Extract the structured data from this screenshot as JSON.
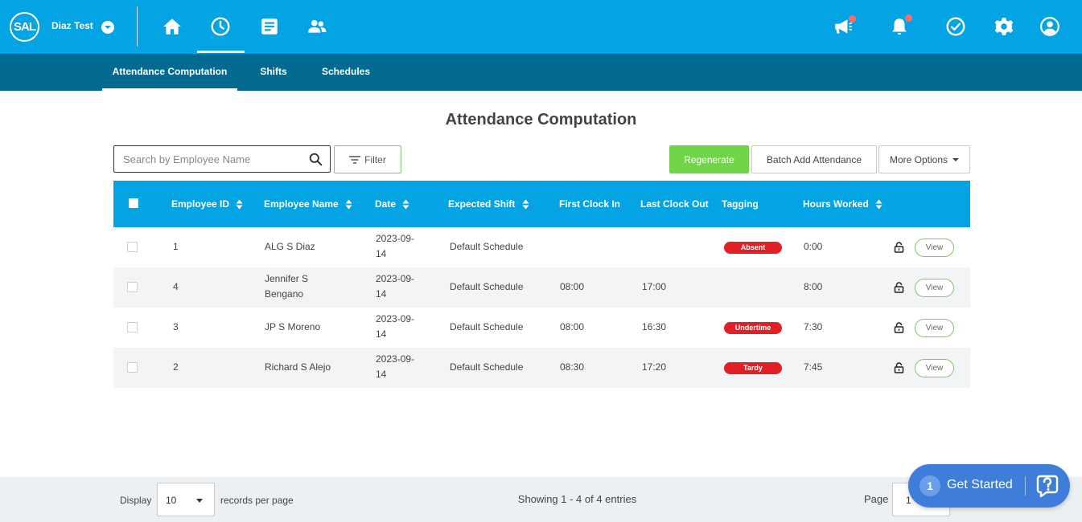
{
  "header": {
    "logo_text": "SAL",
    "company_name": "Diaz Test"
  },
  "subnav": {
    "tabs": [
      {
        "label": "Attendance Computation",
        "active": true
      },
      {
        "label": "Shifts",
        "active": false
      },
      {
        "label": "Schedules",
        "active": false
      }
    ]
  },
  "page": {
    "title": "Attendance Computation"
  },
  "toolbar": {
    "search_placeholder": "Search by Employee Name",
    "filter_label": "Filter",
    "regenerate_label": "Regenerate",
    "batch_label": "Batch Add Attendance",
    "more_label": "More Options"
  },
  "table": {
    "columns": {
      "employee_id": "Employee ID",
      "employee_name": "Employee Name",
      "date": "Date",
      "expected_shift": "Expected Shift",
      "first_clock_in": "First Clock In",
      "last_clock_out": "Last Clock Out",
      "tagging": "Tagging",
      "hours_worked": "Hours Worked"
    },
    "view_label": "View",
    "rows": [
      {
        "id": "1",
        "name_1": "ALG S Diaz",
        "name_2": "",
        "date_1": "2023-09-",
        "date_2": "14",
        "shift": "Default Schedule",
        "clock_in": "",
        "clock_out": "",
        "tag": "Absent",
        "hours": "0:00"
      },
      {
        "id": "4",
        "name_1": "Jennifer S",
        "name_2": "Bengano",
        "date_1": "2023-09-",
        "date_2": "14",
        "shift": "Default Schedule",
        "clock_in": "08:00",
        "clock_out": "17:00",
        "tag": "",
        "hours": "8:00"
      },
      {
        "id": "3",
        "name_1": "JP S Moreno",
        "name_2": "",
        "date_1": "2023-09-",
        "date_2": "14",
        "shift": "Default Schedule",
        "clock_in": "08:00",
        "clock_out": "16:30",
        "tag": "Undertime",
        "hours": "7:30"
      },
      {
        "id": "2",
        "name_1": "Richard S Alejo",
        "name_2": "",
        "date_1": "2023-09-",
        "date_2": "14",
        "shift": "Default Schedule",
        "clock_in": "08:30",
        "clock_out": "17:20",
        "tag": "Tardy",
        "hours": "7:45"
      }
    ]
  },
  "footer": {
    "display_label": "Display",
    "per_page_value": "10",
    "records_label": "records per page",
    "showing_text": "Showing 1 - 4 of 4 entries",
    "page_label": "Page",
    "page_value": "1"
  },
  "get_started": {
    "count": "1",
    "label": "Get Started"
  },
  "colors": {
    "header_bg": "#04a4e4",
    "subnav_bg": "#036b92",
    "regenerate_bg": "#71d54a",
    "tag_red": "#e31f26",
    "notification_dot": "#ff6b6b",
    "get_started_bg": "#3f7ddb"
  },
  "icons": {
    "nav": [
      "home-icon",
      "clock-icon",
      "document-icon",
      "people-icon"
    ],
    "right": [
      "megaphone-icon",
      "bell-icon",
      "check-circle-icon",
      "gear-icon",
      "user-icon"
    ]
  }
}
